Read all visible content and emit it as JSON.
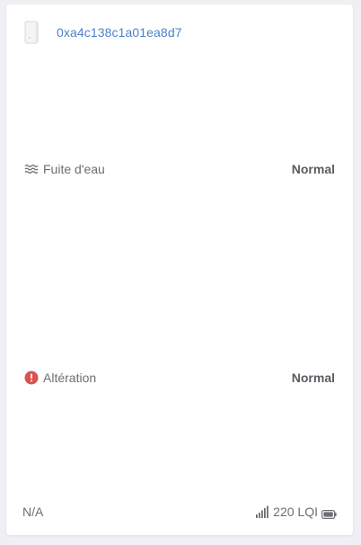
{
  "device": {
    "id": "0xa4c138c1a01ea8d7",
    "icon": "device-sensor-icon"
  },
  "water_leak": {
    "icon": "water-waves-icon",
    "label": "Fuite d'eau",
    "value": "Normal"
  },
  "tamper": {
    "icon": "alert-circle-icon",
    "label": "Altération",
    "value": "Normal",
    "icon_color": "#d9534f"
  },
  "footer": {
    "last_seen": "N/A",
    "signal_icon": "signal-bars-icon",
    "lqi": "220 LQI",
    "battery_icon": "battery-icon"
  },
  "colors": {
    "link": "#4e7fcf",
    "text": "#6d6d75",
    "value": "#5a5a62",
    "alert": "#d9534f"
  }
}
